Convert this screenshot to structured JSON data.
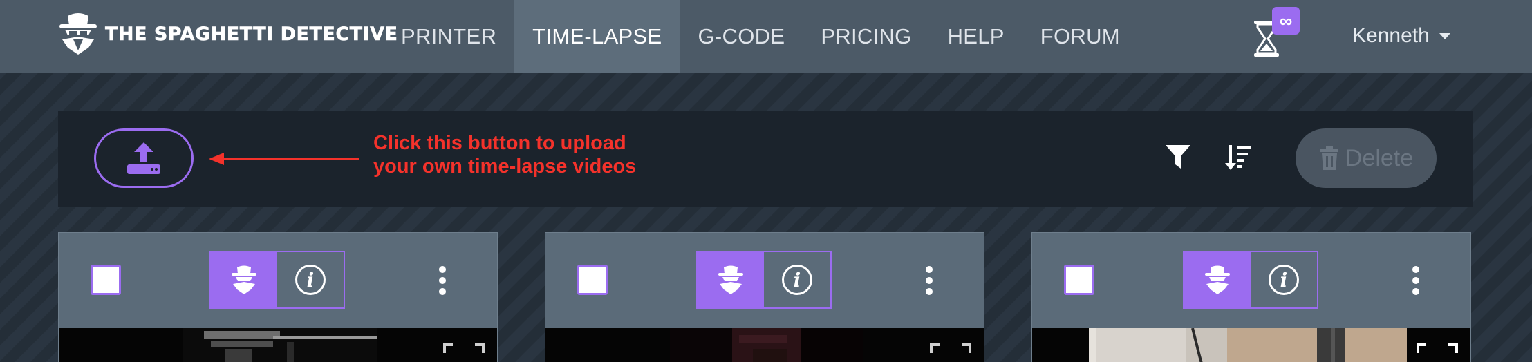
{
  "navbar": {
    "brand": "THE SPAGHETTI DETECTIVE",
    "links": [
      "PRINTER",
      "TIME-LAPSE",
      "G-CODE",
      "PRICING",
      "HELP",
      "FORUM"
    ],
    "active_link": "TIME-LAPSE",
    "credit_badge": "∞",
    "user": "Kenneth"
  },
  "toolbar": {
    "hint_line1": "Click this button to upload",
    "hint_line2": "your own time-lapse videos",
    "delete_label": "Delete"
  },
  "cards": [
    {
      "info_label": "i"
    },
    {
      "info_label": "i"
    },
    {
      "info_label": "i"
    }
  ],
  "colors": {
    "accent": "#9b6cf0",
    "navbar": "#4c5a67",
    "hint": "#f4322b",
    "toolbar": "#1b232c",
    "card": "#5b6b79"
  }
}
